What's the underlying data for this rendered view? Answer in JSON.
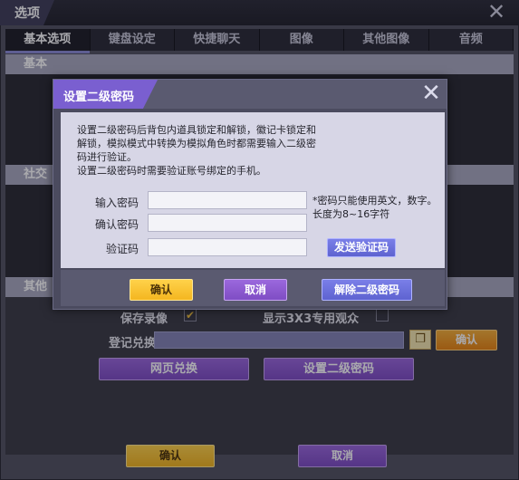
{
  "window": {
    "title": "选项"
  },
  "tabs": [
    {
      "label": "基本选项",
      "active": true
    },
    {
      "label": "键盘设定"
    },
    {
      "label": "快捷聊天"
    },
    {
      "label": "图像"
    },
    {
      "label": "其他图像"
    },
    {
      "label": "音频"
    }
  ],
  "sections": {
    "basic": "基本",
    "social": "社交",
    "other": "其他"
  },
  "other": {
    "save_recording": "保存录像",
    "show_3x3": "显示3X3专用观众",
    "redeem_label": "登记兑换券",
    "redeem_confirm": "确认",
    "web_redeem": "网页兑换",
    "set_secondary_password": "设置二级密码"
  },
  "footer": {
    "confirm": "确认",
    "cancel": "取消"
  },
  "modal": {
    "title": "设置二级密码",
    "desc_lines": [
      "设置二级密码后背包内道具锁定和解锁，徽记卡锁定和",
      "解锁，模拟模式中转换为模拟角色时都需要输入二级密",
      "码进行验证。",
      "设置二级密码时需要验证账号绑定的手机。"
    ],
    "fields": {
      "password_label": "输入密码",
      "confirm_label": "确认密码",
      "code_label": "验证码"
    },
    "hint_lines": [
      "*密码只能使用英文，数字。",
      "长度为8~16字符"
    ],
    "send_code": "发送验证码",
    "confirm": "确认",
    "cancel": "取消",
    "remove": "解除二级密码"
  },
  "colors": {
    "accent_purple": "#7a5fd0",
    "orange": "#e98512",
    "yellow": "#f4b620",
    "blue": "#5e63d0"
  },
  "icons": {
    "close": "close-icon",
    "paste": "paste-icon",
    "check": "check-icon"
  }
}
